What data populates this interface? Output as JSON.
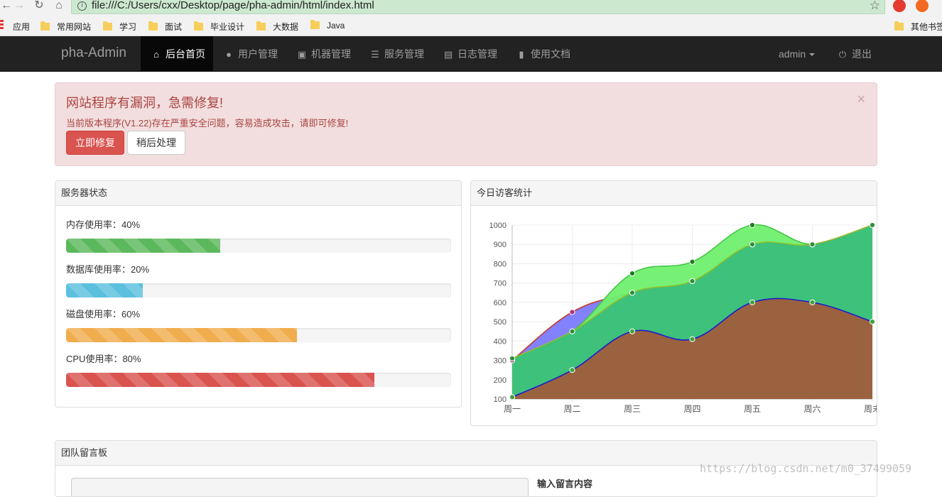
{
  "browser": {
    "url": "file:///C:/Users/cxx/Desktop/page/pha-admin/html/index.html",
    "bookmarks": [
      "应用",
      "常用网站",
      "学习",
      "面试",
      "毕业设计",
      "大数据",
      "Java"
    ],
    "other_bookmarks": "其他书签"
  },
  "navbar": {
    "brand": "pha-Admin",
    "items": [
      {
        "label": "后台首页",
        "icon": "home-icon",
        "active": true
      },
      {
        "label": "用户管理",
        "icon": "user-icon"
      },
      {
        "label": "机器管理",
        "icon": "machine-icon"
      },
      {
        "label": "服务管理",
        "icon": "server-icon"
      },
      {
        "label": "日志管理",
        "icon": "log-icon"
      },
      {
        "label": "使用文档",
        "icon": "book-icon"
      }
    ],
    "user": "admin",
    "logout": "退出"
  },
  "alert": {
    "title": "网站程序有漏洞，急需修复!",
    "message": "当前版本程序(V1.22)存在严重安全问题，容易造成攻击，请即可修复!",
    "fix_button": "立即修复",
    "later_button": "稍后处理",
    "close": "×"
  },
  "server_panel": {
    "title": "服务器状态",
    "metrics": [
      {
        "label": "内存使用率：40%",
        "percent": 40,
        "color": "#5cb85c"
      },
      {
        "label": "数据库使用率：20%",
        "percent": 20,
        "color": "#5bc0de"
      },
      {
        "label": "磁盘使用率：60%",
        "percent": 60,
        "color": "#f0ad4e"
      },
      {
        "label": "CPU使用率：80%",
        "percent": 80,
        "color": "#d9534f"
      }
    ]
  },
  "visit_panel": {
    "title": "今日访客统计"
  },
  "board_panel": {
    "title": "团队留言板",
    "input_label": "输入留言内容"
  },
  "watermark": "https://blog.csdn.net/m0_37499059",
  "chart_data": {
    "type": "area",
    "categories": [
      "周一",
      "周二",
      "周三",
      "周四",
      "周五",
      "周六",
      "周末"
    ],
    "ylim": [
      100,
      1000
    ],
    "yticks": [
      100,
      200,
      300,
      400,
      500,
      600,
      700,
      800,
      900,
      1000
    ],
    "grid": true,
    "series": [
      {
        "values": [
          300,
          550,
          650,
          710,
          900,
          900,
          1000
        ],
        "fill": "#7b7bff",
        "stroke": "#c43b2e",
        "point": "#b0307a"
      },
      {
        "values": [
          310,
          450,
          750,
          810,
          1000,
          900,
          1000
        ],
        "fill": "#6ff06f",
        "stroke": "#46c446",
        "point": "#1c7c1c"
      },
      {
        "values": [
          310,
          450,
          650,
          710,
          900,
          900,
          1000
        ],
        "fill": "#3bbf7a",
        "stroke": "#8fbf2a",
        "point": "#2e8f3c"
      },
      {
        "values": [
          110,
          250,
          450,
          410,
          600,
          600,
          500
        ],
        "fill": "#a05d3c",
        "stroke": "#1b1bd0",
        "point": "#3ea33e"
      }
    ]
  }
}
